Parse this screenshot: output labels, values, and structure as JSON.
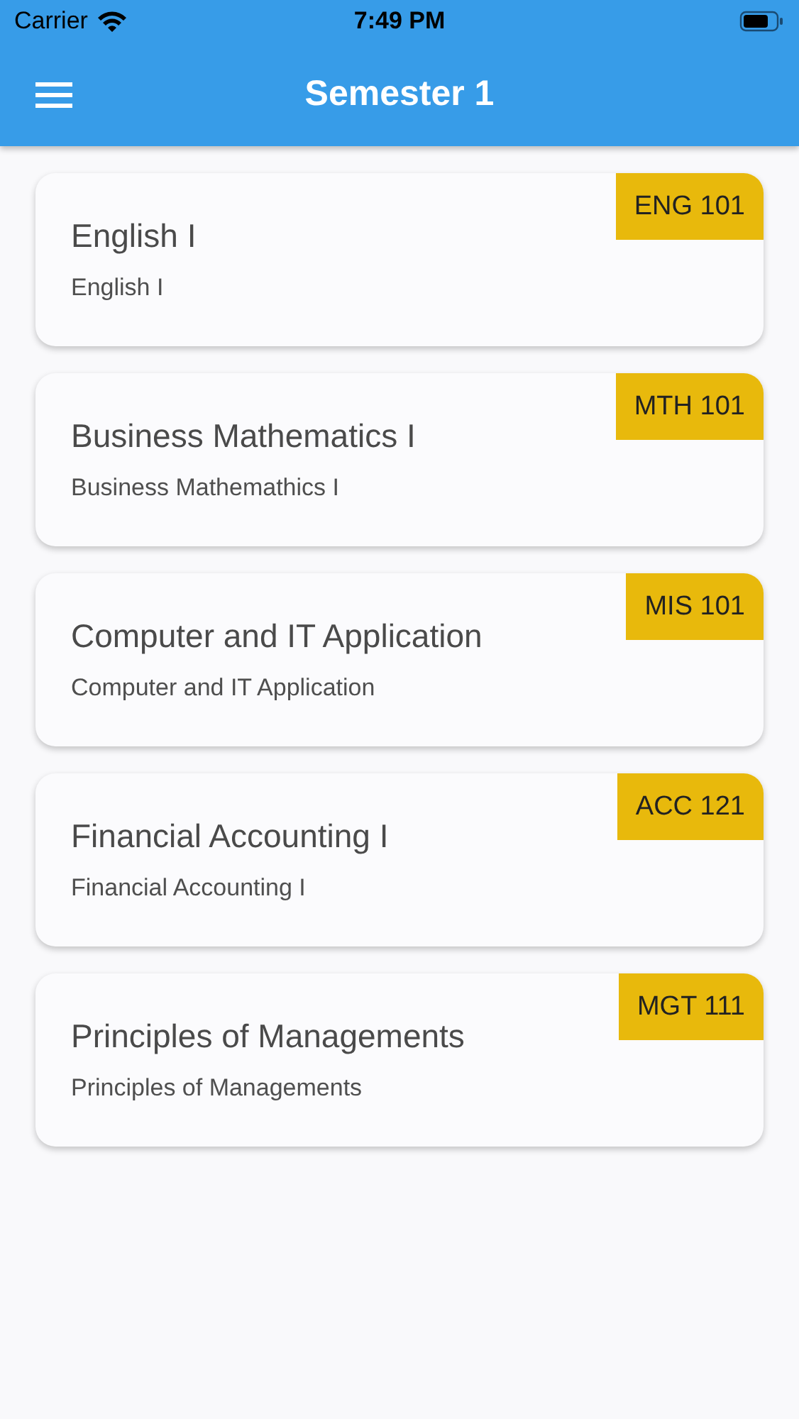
{
  "status_bar": {
    "carrier": "Carrier",
    "time": "7:49 PM"
  },
  "app_bar": {
    "title": "Semester 1"
  },
  "courses": [
    {
      "title": "English I",
      "subtitle": "English I",
      "code": "ENG 101"
    },
    {
      "title": "Business Mathematics I",
      "subtitle": "Business Mathemathics I",
      "code": "MTH 101"
    },
    {
      "title": "Computer and IT Application",
      "subtitle": "Computer and IT Application",
      "code": "MIS 101"
    },
    {
      "title": "Financial Accounting I",
      "subtitle": "Financial Accounting I",
      "code": "ACC 121"
    },
    {
      "title": "Principles of Managements",
      "subtitle": "Principles of Managements",
      "code": "MGT 111"
    }
  ]
}
